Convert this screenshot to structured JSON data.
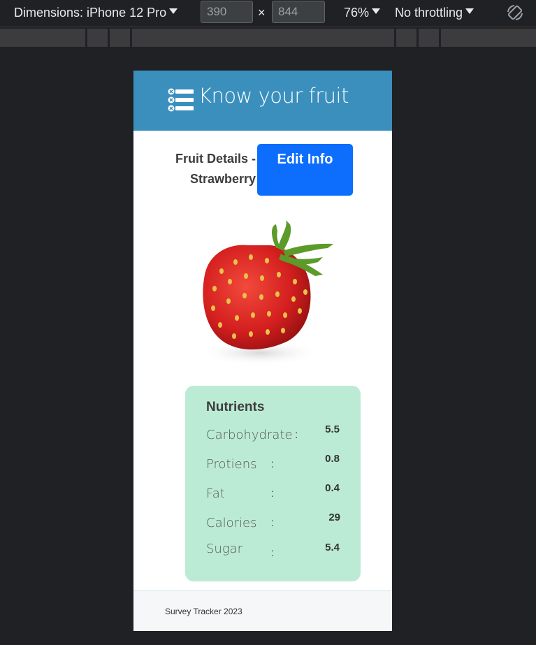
{
  "devtools": {
    "dimensions_label": "Dimensions: iPhone 12 Pro",
    "width_value": "390",
    "height_value": "844",
    "times_symbol": "×",
    "zoom_label": "76%",
    "throttling_label": "No throttling"
  },
  "app": {
    "title": "Know your fruit",
    "header_color": "#3a8fbd",
    "details_title": "Fruit Details - Strawberry",
    "edit_button_label": "Edit Info",
    "accent_color": "#0d6efd"
  },
  "nutrients": {
    "title": "Nutrients",
    "card_color": "#bcebd5",
    "items": [
      {
        "name": "Carbohydrate",
        "value": "5.5"
      },
      {
        "name": "Protiens",
        "value": "0.8"
      },
      {
        "name": "Fat",
        "value": "0.4"
      },
      {
        "name": "Calories",
        "value": "29"
      },
      {
        "name": "Sugar",
        "value": "5.4"
      }
    ],
    "separator": ":"
  },
  "footer": {
    "text": "Survey Tracker 2023"
  },
  "icons": {
    "logo": "checklist-icon",
    "rotate": "rotate-device-icon",
    "fruit": "strawberry-image"
  }
}
